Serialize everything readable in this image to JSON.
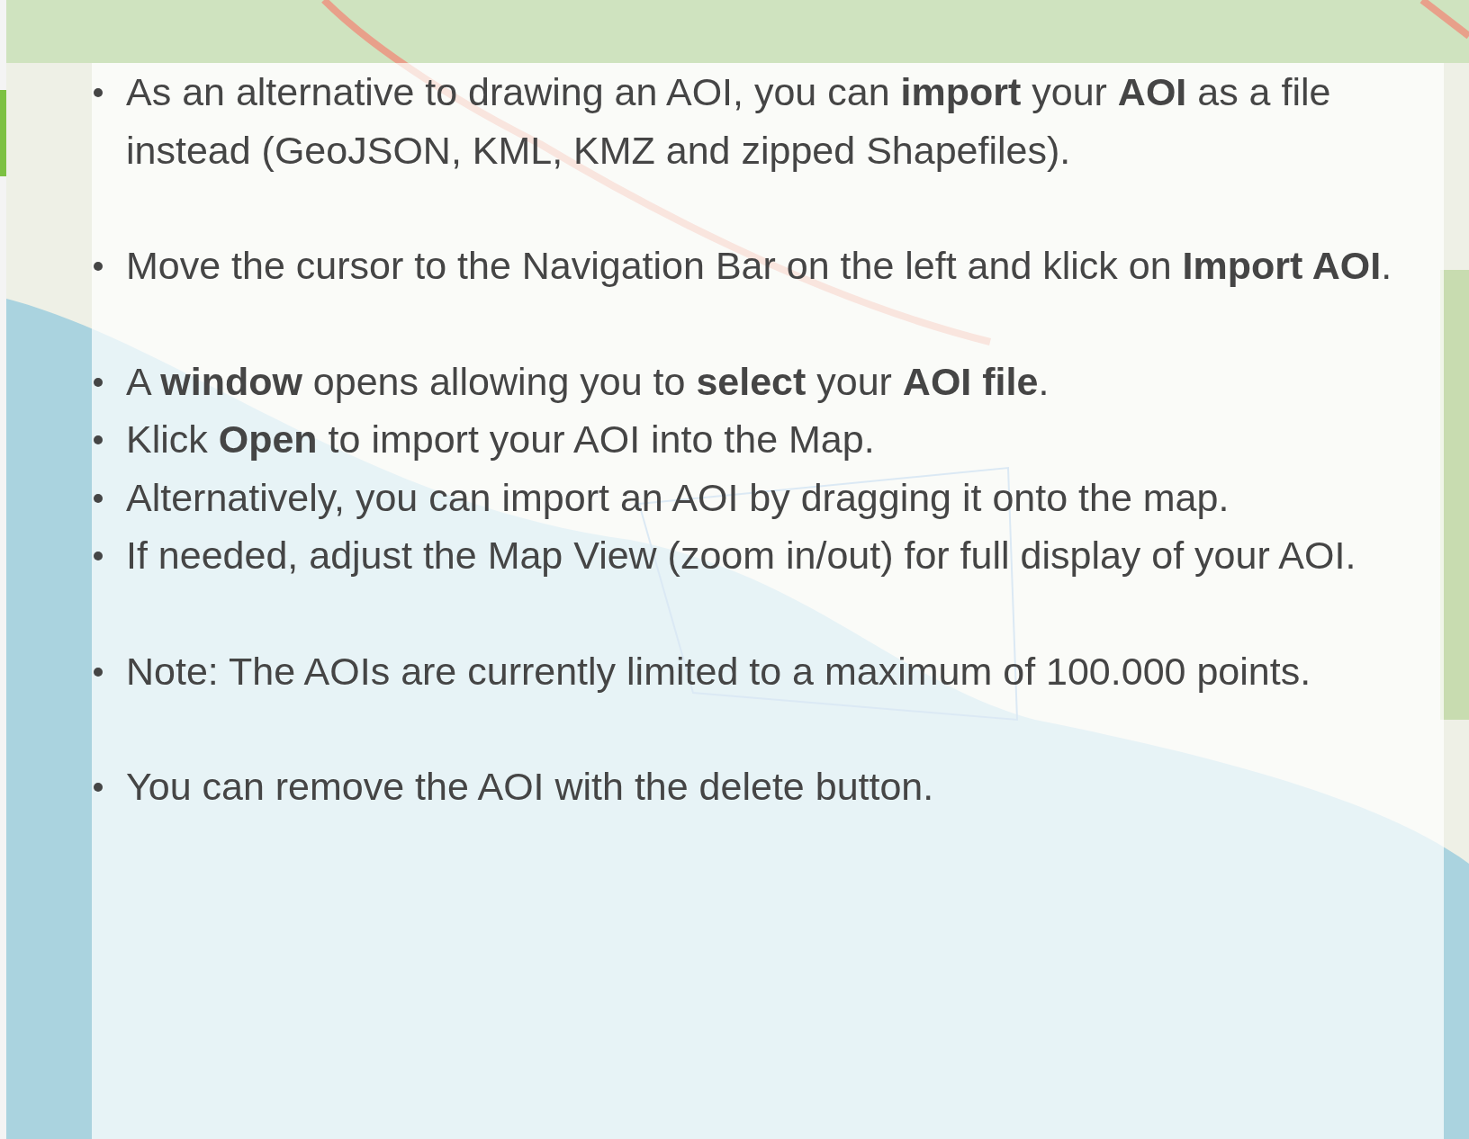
{
  "help_panel": {
    "groups": [
      {
        "items": [
          "As an alternative to drawing an AOI, you can **import** your **AOI** as a file instead (GeoJSON, KML, KMZ and zipped Shapefiles)."
        ]
      },
      {
        "items": [
          "Move the cursor to the Navigation Bar on the left and klick on **Import AOI**."
        ]
      },
      {
        "items": [
          "A **window** opens allowing you to **select** your **AOI file**.",
          "Klick **Open** to import your AOI into the Map.",
          "Alternatively, you can import an AOI by dragging it onto the map.",
          "If needed, adjust the Map View (zoom in/out) for full display of your AOI."
        ]
      },
      {
        "items": [
          "Note: The AOIs are currently limited to a maximum of 100.000 points."
        ]
      },
      {
        "items": [
          "You can remove the AOI with the delete button."
        ]
      }
    ]
  }
}
